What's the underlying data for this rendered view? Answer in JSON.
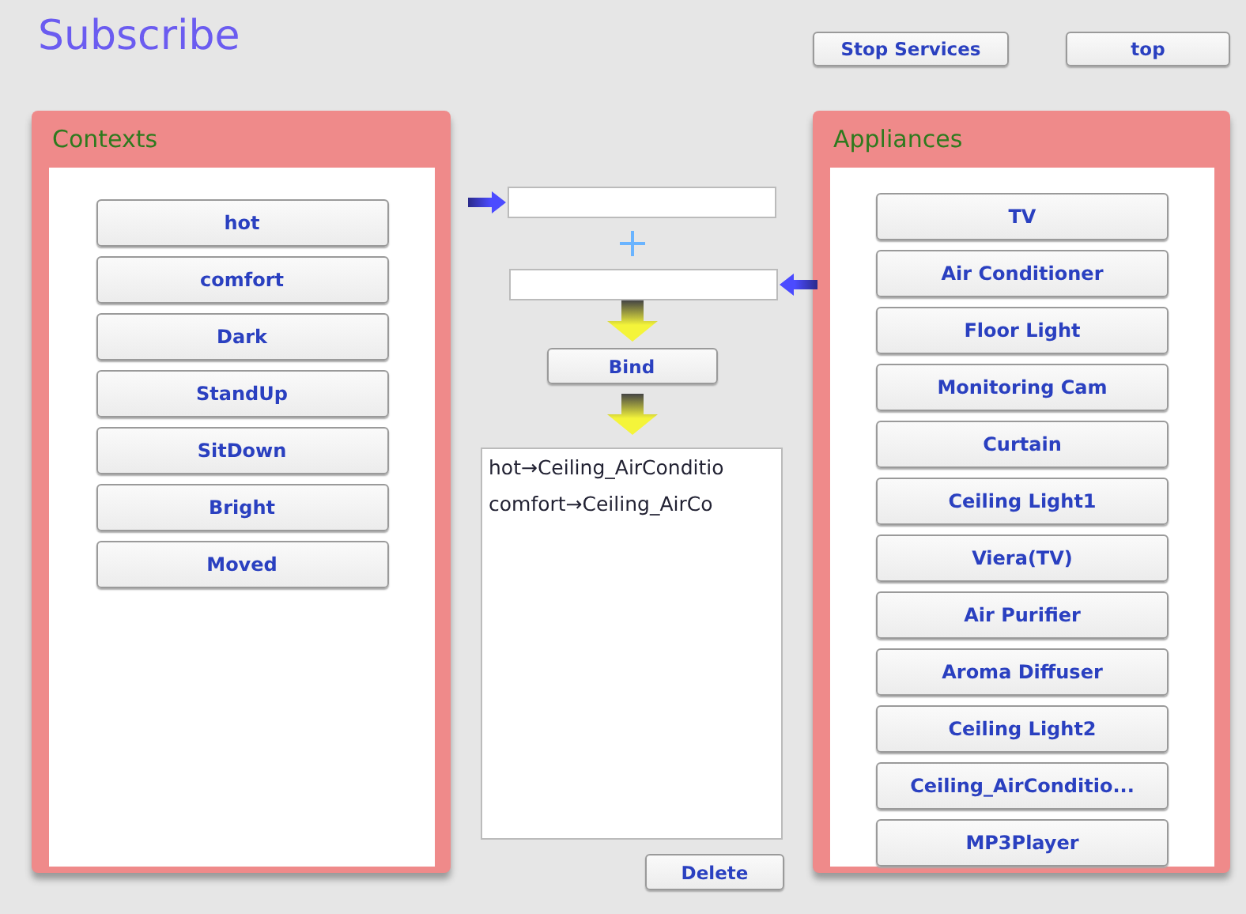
{
  "title": "Subscribe",
  "top_buttons": [
    "Stop Services",
    "top"
  ],
  "contexts": {
    "title": "Contexts",
    "items": [
      "hot",
      "comfort",
      "Dark",
      "StandUp",
      "SitDown",
      "Bright",
      "Moved"
    ]
  },
  "bind_button": "Bind",
  "bindings": [
    "hot→Ceiling_AirConditio",
    "comfort→Ceiling_AirCo"
  ],
  "delete_button": "Delete",
  "appliances": {
    "title": "Appliances",
    "items": [
      "TV",
      "Air Conditioner",
      "Floor Light",
      "Monitoring Cam",
      "Curtain",
      "Ceiling Light1",
      "Viera(TV)",
      "Air Purifier",
      "Aroma Diffuser",
      "Ceiling Light2",
      "Ceiling_AirConditio...",
      "MP3Player"
    ]
  }
}
